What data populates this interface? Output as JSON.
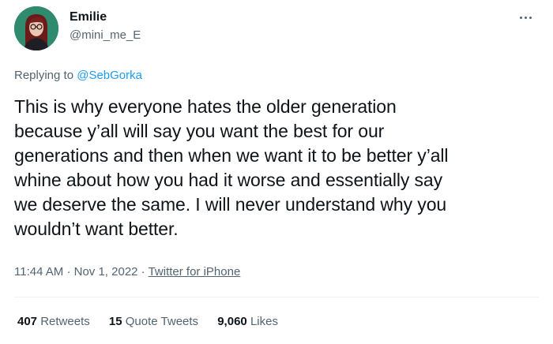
{
  "author": {
    "display_name": "Emilie",
    "handle": "@mini_me_E",
    "avatar_icon": "user-avatar"
  },
  "reply": {
    "prefix": "Replying to",
    "mention": "@SebGorka"
  },
  "tweet": {
    "lines": [
      "This is why everyone hates the older generation",
      "because y’all will say you want the best for our",
      "generations and then when we want it to be better y’all",
      "whine about how you had it worse and essentially say",
      "we deserve the same. I will never understand why you",
      "wouldn’t want better."
    ]
  },
  "meta": {
    "time": "11:44 AM",
    "separator": "·",
    "date": "Nov 1, 2022",
    "source": "Twitter for iPhone"
  },
  "stats": {
    "retweets_count": "407",
    "retweets_label": "Retweets",
    "quote_count": "15",
    "quote_label": "Quote Tweets",
    "likes_count": "9,060",
    "likes_label": "Likes"
  },
  "colors": {
    "accent": "#1d9bf0",
    "text_primary": "#0f1419",
    "text_secondary": "#536471",
    "divider": "#eff3f4"
  },
  "more_icon": "more-horizontal-icon"
}
